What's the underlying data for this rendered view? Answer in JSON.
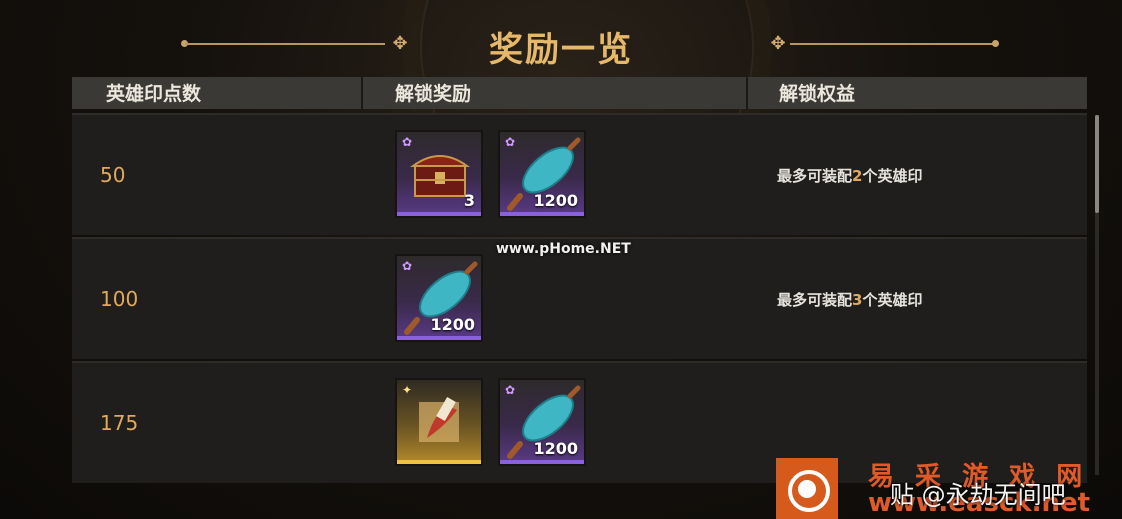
{
  "title": "奖励一览",
  "headers": {
    "points": "英雄印点数",
    "rewards": "解锁奖励",
    "benefits": "解锁权益"
  },
  "rows": [
    {
      "points": "50",
      "benefit_pre": "最多可装配",
      "benefit_num": "2",
      "benefit_post": "个英雄印",
      "items": [
        {
          "icon": "treasure-chest-icon",
          "rarity": "purple",
          "count": "3"
        },
        {
          "icon": "jade-cocoon-icon",
          "rarity": "purple",
          "count": "1200"
        }
      ]
    },
    {
      "points": "100",
      "benefit_pre": "最多可装配",
      "benefit_num": "3",
      "benefit_post": "个英雄印",
      "items": [
        {
          "icon": "jade-cocoon-icon",
          "rarity": "purple",
          "count": "1200"
        }
      ]
    },
    {
      "points": "175",
      "benefit_pre": "",
      "benefit_num": "",
      "benefit_post": "",
      "items": [
        {
          "icon": "hero-seal-icon",
          "rarity": "gold",
          "count": ""
        },
        {
          "icon": "jade-cocoon-icon",
          "rarity": "purple",
          "count": "1200"
        }
      ]
    }
  ],
  "watermarks": {
    "center": "www.pHome.NET",
    "site_name": "易 采 游 戏 网",
    "site_url": "www.easck.net",
    "tieba": "贴 @永劫无间吧"
  },
  "colors": {
    "accent": "#e2a95c",
    "purple": "#8a5fe0",
    "gold": "#f0c040"
  }
}
